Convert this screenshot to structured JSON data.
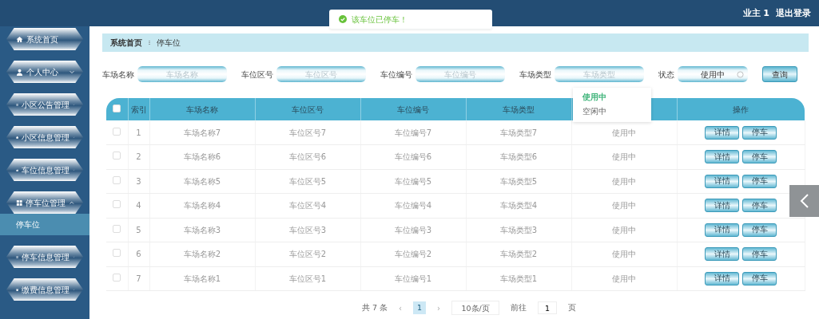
{
  "header": {
    "user": "业主 1",
    "logout": "退出登录"
  },
  "toast": {
    "text": "该车位已停车！"
  },
  "sidebar": {
    "items": [
      {
        "label": "系统首页",
        "kind": "link"
      },
      {
        "label": "个人中心",
        "kind": "menu",
        "expanded": false
      },
      {
        "label": "小区公告管理",
        "kind": "menu",
        "expanded": false
      },
      {
        "label": "小区信息管理",
        "kind": "menu",
        "expanded": false
      },
      {
        "label": "车位信息管理",
        "kind": "menu",
        "expanded": false
      },
      {
        "label": "停车位管理",
        "kind": "menu",
        "expanded": true,
        "children": [
          {
            "label": "停车位",
            "selected": true
          }
        ]
      },
      {
        "label": "停车信息管理",
        "kind": "menu",
        "expanded": false
      },
      {
        "label": "缴费信息管理",
        "kind": "menu",
        "expanded": false
      }
    ]
  },
  "breadcrumb": [
    "系统首页",
    "停车位"
  ],
  "filters": [
    {
      "label": "车场名称",
      "placeholder": "车场名称"
    },
    {
      "label": "车位区号",
      "placeholder": "车位区号"
    },
    {
      "label": "车位编号",
      "placeholder": "车位编号"
    },
    {
      "label": "车场类型",
      "placeholder": "车场类型"
    }
  ],
  "status_filter": {
    "label": "状态",
    "value": "使用中",
    "options": [
      {
        "label": "使用中",
        "selected": true
      },
      {
        "label": "空闲中",
        "selected": false
      }
    ]
  },
  "search_button": "查询",
  "table": {
    "columns": [
      "索引",
      "车场名称",
      "车位区号",
      "车位编号",
      "车场类型",
      null,
      "操作"
    ],
    "header_checked": false,
    "rows": [
      {
        "checked": false,
        "cells": [
          "1",
          "车场名称7",
          "车位区号7",
          "车位编号7",
          "车场类型7",
          "使用中"
        ],
        "actions": [
          "详情",
          "停车"
        ]
      },
      {
        "checked": false,
        "cells": [
          "2",
          "车场名称6",
          "车位区号6",
          "车位编号6",
          "车场类型6",
          "使用中"
        ],
        "actions": [
          "详情",
          "停车"
        ]
      },
      {
        "checked": false,
        "cells": [
          "3",
          "车场名称5",
          "车位区号5",
          "车位编号5",
          "车场类型5",
          "使用中"
        ],
        "actions": [
          "详情",
          "停车"
        ]
      },
      {
        "checked": false,
        "cells": [
          "4",
          "车场名称4",
          "车位区号4",
          "车位编号4",
          "车场类型4",
          "使用中"
        ],
        "actions": [
          "详情",
          "停车"
        ]
      },
      {
        "checked": false,
        "cells": [
          "5",
          "车场名称3",
          "车位区号3",
          "车位编号3",
          "车场类型3",
          "使用中"
        ],
        "actions": [
          "详情",
          "停车"
        ]
      },
      {
        "checked": false,
        "cells": [
          "6",
          "车场名称2",
          "车位区号2",
          "车位编号2",
          "车场类型2",
          "使用中"
        ],
        "actions": [
          "详情",
          "停车"
        ]
      },
      {
        "checked": false,
        "cells": [
          "7",
          "车场名称1",
          "车位区号1",
          "车位编号1",
          "车场类型1",
          "使用中"
        ],
        "actions": [
          "详情",
          "停车"
        ]
      }
    ]
  },
  "pagination": {
    "total": "共 7 条",
    "prev": "‹",
    "pages": [
      {
        "label": "1",
        "selected": true
      }
    ],
    "next": "›",
    "page_size": "10条/页",
    "goto": "前往",
    "goto_value": "1",
    "page_unit": "页"
  }
}
